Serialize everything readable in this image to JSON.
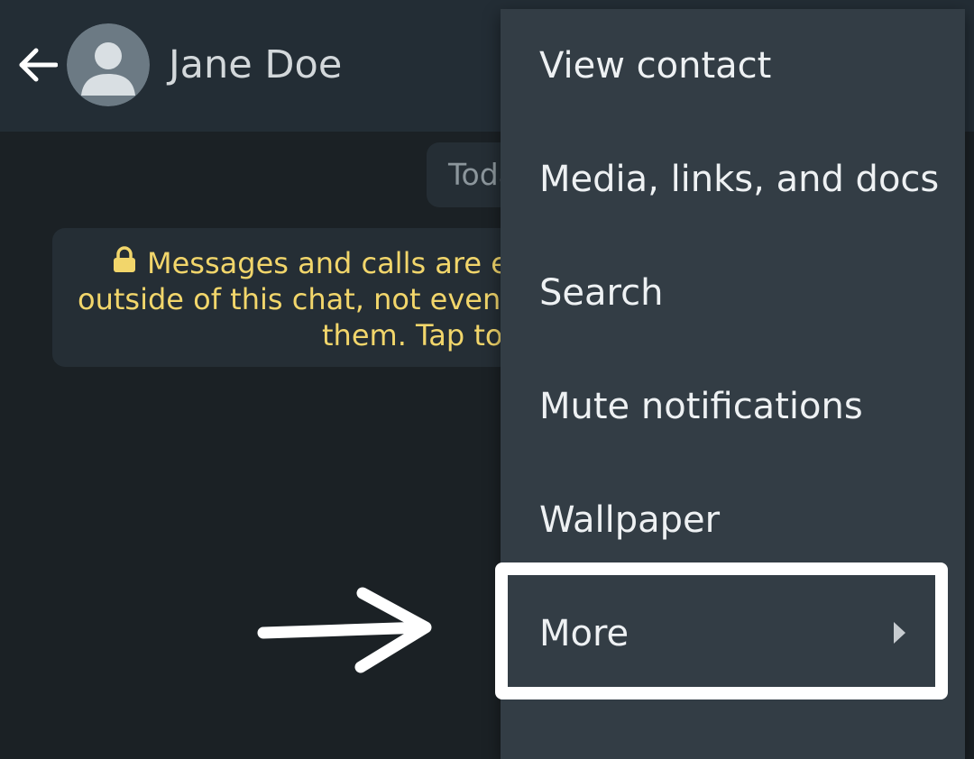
{
  "header": {
    "contact_name": "Jane Doe",
    "icons": {
      "back": "back-arrow-icon",
      "avatar": "default-avatar-icon"
    }
  },
  "chat": {
    "date_chip": "Toda",
    "encryption_notice": {
      "line1": "Messages and calls are enc",
      "line2": "outside of this chat, not even W",
      "line3": "them. Tap to",
      "icon": "lock-icon"
    }
  },
  "menu": {
    "items": [
      {
        "label": "View contact"
      },
      {
        "label": "Media, links, and docs"
      },
      {
        "label": "Search"
      },
      {
        "label": "Mute notifications"
      },
      {
        "label": "Wallpaper"
      },
      {
        "label": "More",
        "submenu_icon": "chevron-right-icon"
      }
    ]
  },
  "annotation": {
    "arrow_icon": "pointer-arrow-icon",
    "highlight_target": "More"
  },
  "colors": {
    "header_bg": "#232d35",
    "chat_bg": "#1b2125",
    "bubble_bg": "#252e35",
    "menu_bg": "#333d45",
    "notice_text": "#f2d66b",
    "menu_text": "#eef1f3",
    "annotation": "#ffffff"
  }
}
